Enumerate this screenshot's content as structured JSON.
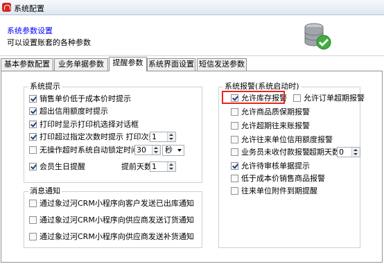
{
  "window": {
    "title": "系统配置"
  },
  "header": {
    "title": "系统参数设置",
    "subtitle": "可以设置账套的各种参数"
  },
  "tabs": [
    {
      "label": "基本参数配置"
    },
    {
      "label": "业务单据参数"
    },
    {
      "label": "提醒参数"
    },
    {
      "label": "系统界面设置"
    },
    {
      "label": "短信发送参数"
    }
  ],
  "system_tips": {
    "title": "系统提示",
    "items": [
      {
        "label": "销售单价低于成本价时提示",
        "checked": true
      },
      {
        "label": "超出信用额度时提示",
        "checked": true
      },
      {
        "label": "打印时显示打印机选择对话框",
        "checked": true
      },
      {
        "label": "打印超过指定次数时提示  打印次数",
        "checked": true
      },
      {
        "label": "无操作超时系统自动锁定时间",
        "checked": false
      },
      {
        "label": "会员生日提醒",
        "checked": true
      }
    ],
    "print_count": "1",
    "lock_time_value": "30",
    "lock_time_unit": "秒",
    "advance_days_label": "提前天数",
    "advance_days_value": "1"
  },
  "message_notify": {
    "title": "消息通知",
    "items": [
      {
        "label": "通过象过河CRM小程序向客户发送已出库通知",
        "checked": false
      },
      {
        "label": "通过象过河CRM小程序向供应商发送订货通知",
        "checked": false
      },
      {
        "label": "通过象过河CRM小程序向供应商发送补货通知",
        "checked": false
      }
    ]
  },
  "system_alarm": {
    "title": "系统报警(系统启动时)",
    "items": [
      {
        "label": "允许库存报警",
        "checked": true
      },
      {
        "label": "允许订单超期报警",
        "checked": false
      },
      {
        "label": "允许商品质保期报警",
        "checked": false
      },
      {
        "label": "允许超期往来账报警",
        "checked": false
      },
      {
        "label": "允许往来单位信用额度报警",
        "checked": false
      },
      {
        "label": "业务员未收付款报警",
        "checked": false
      },
      {
        "label": "允许待审核单据提示",
        "checked": true
      },
      {
        "label": "低于成本价销售商品报警",
        "checked": false
      },
      {
        "label": "往来单位附件到期提醒",
        "checked": false
      }
    ],
    "overdue_days_label": "超期天数",
    "overdue_days_value": "0"
  },
  "colors": {
    "highlight": "#e8251d",
    "header_title": "#0000ff",
    "app_icon": "#d8251d"
  }
}
